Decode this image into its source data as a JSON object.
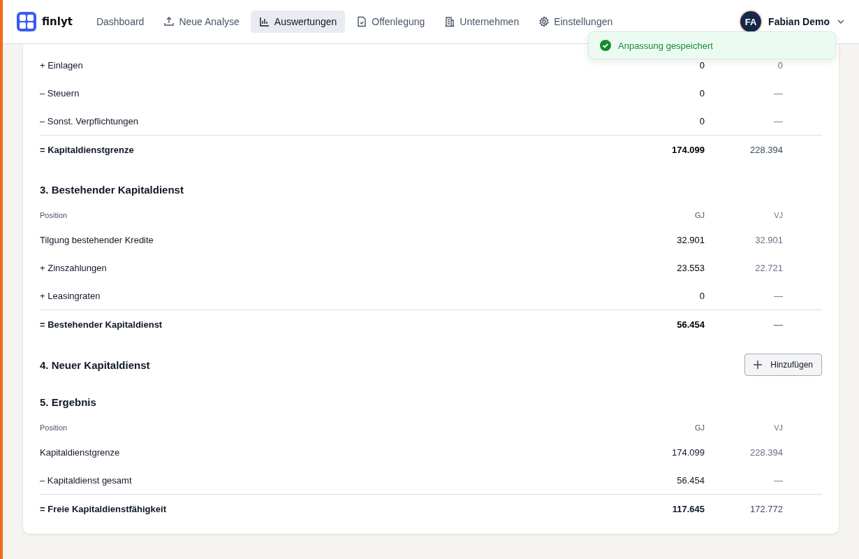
{
  "header": {
    "logo": "finlyt",
    "nav": [
      {
        "label": "Dashboard",
        "kind": "plain",
        "selected": false
      },
      {
        "label": "Neue Analyse",
        "kind": "upload",
        "selected": false
      },
      {
        "label": "Auswertungen",
        "kind": "chart",
        "selected": true
      },
      {
        "label": "Offenlegung",
        "kind": "document",
        "selected": false
      },
      {
        "label": "Unternehmen",
        "kind": "building",
        "selected": false
      },
      {
        "label": "Einstellungen",
        "kind": "gear",
        "selected": false
      }
    ],
    "user": {
      "initials": "FA",
      "name": "Fabian Demo"
    }
  },
  "toast": {
    "message": "Anpassung gespeichert"
  },
  "sections": [
    {
      "gj_bold": true,
      "rows": [
        {
          "kind": "item",
          "label": "+ Einlagen",
          "gj": "0",
          "vj": "0"
        },
        {
          "kind": "item",
          "label": "– Steuern",
          "gj": "0",
          "vj": "—"
        },
        {
          "kind": "item",
          "label": "– Sonst. Verpflichtungen",
          "gj": "0",
          "vj": "—"
        },
        {
          "kind": "total",
          "label": "= Kapitaldienstgrenze",
          "gj": "174.099",
          "vj": "228.394"
        }
      ]
    },
    {
      "title": "3. Bestehender Kapitaldienst",
      "gj_bold": true,
      "columns": [
        "Position",
        "GJ",
        "VJ"
      ],
      "rows": [
        {
          "kind": "item",
          "label": "Tilgung bestehender Kredite",
          "gj": "32.901",
          "vj": "32.901"
        },
        {
          "kind": "item",
          "label": "+ Zinszahlungen",
          "gj": "23.553",
          "vj": "22.721"
        },
        {
          "kind": "item",
          "label": "+ Leasingraten",
          "gj": "0",
          "vj": "—"
        },
        {
          "kind": "total",
          "label": "= Bestehender Kapitaldienst",
          "gj": "56.454",
          "vj": "—"
        }
      ]
    },
    {
      "title": "4. Neuer Kapitaldienst",
      "button": "Hinzufügen"
    },
    {
      "title": "5. Ergebnis",
      "gj_bold": false,
      "columns": [
        "Position",
        "GJ",
        "VJ"
      ],
      "rows": [
        {
          "kind": "item",
          "label": "Kapitaldienstgrenze",
          "gj": "174.099",
          "vj": "228.394"
        },
        {
          "kind": "item",
          "label": "– Kapitaldienst gesamt",
          "gj": "56.454",
          "vj": "—"
        },
        {
          "kind": "total",
          "label": "= Freie Kapitaldienstfähigkeit",
          "gj": "117.645",
          "vj": "172.772"
        }
      ]
    }
  ]
}
